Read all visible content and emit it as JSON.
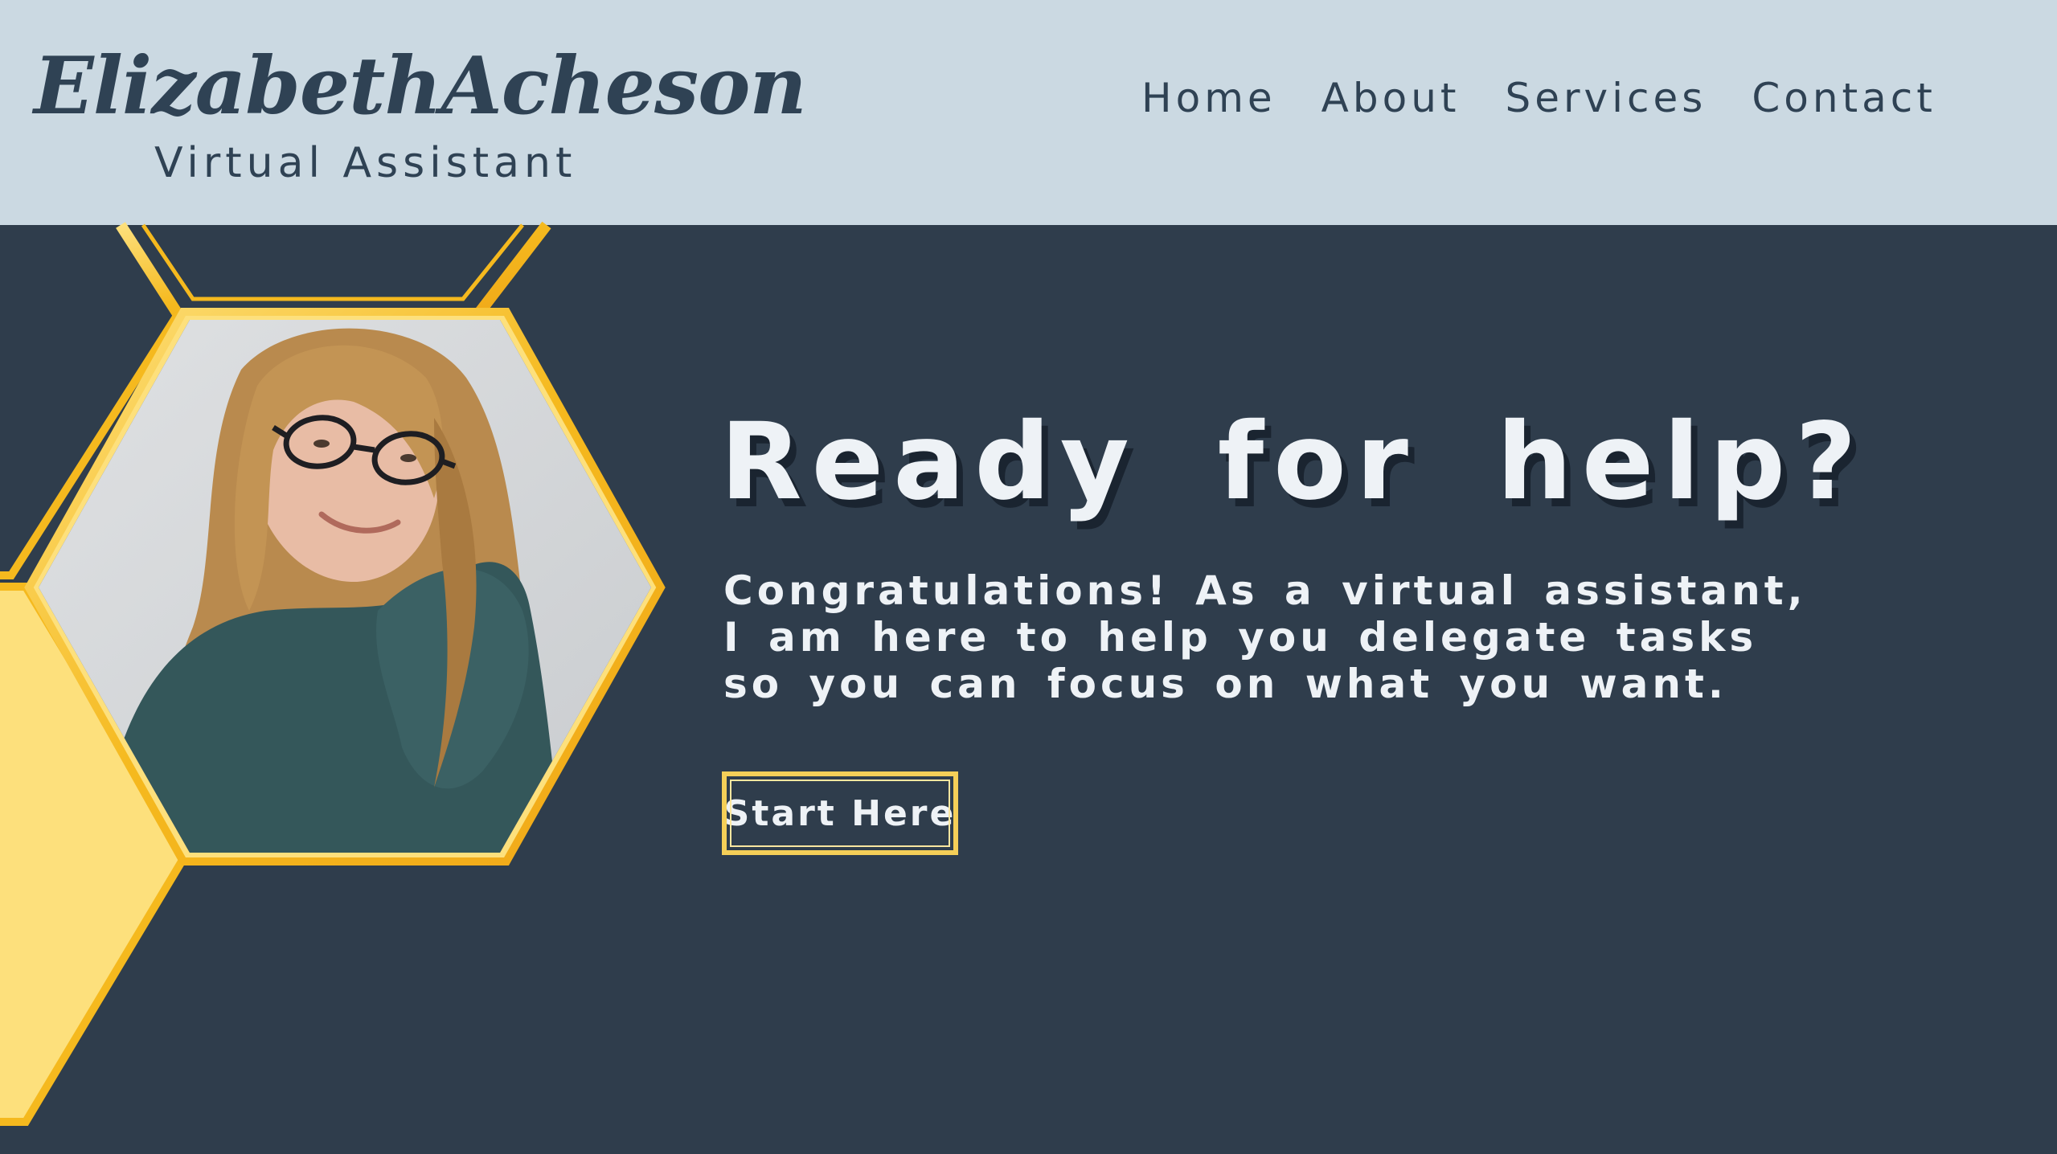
{
  "header": {
    "brand_name": "ElizabethAcheson",
    "tagline": "Virtual Assistant",
    "nav": [
      {
        "label": "Home"
      },
      {
        "label": "About"
      },
      {
        "label": "Services"
      },
      {
        "label": "Contact"
      }
    ]
  },
  "hero": {
    "title": "Ready for help?",
    "text_lines": [
      "Congratulations! As a virtual assistant,",
      "I am here to help you delegate tasks",
      "so you can focus on what you want."
    ],
    "cta_label": "Start Here"
  },
  "colors": {
    "header_bg": "#cbd9e2",
    "page_bg": "#2f3d4c",
    "accent_gold": "#f5b91e",
    "accent_light_yellow": "#fde07c",
    "text_dark": "#2f4254",
    "text_light": "#eef2f6"
  },
  "icons": {
    "photo": "portrait-photo",
    "hexagon_frame": "hexagon-frame-decor"
  }
}
